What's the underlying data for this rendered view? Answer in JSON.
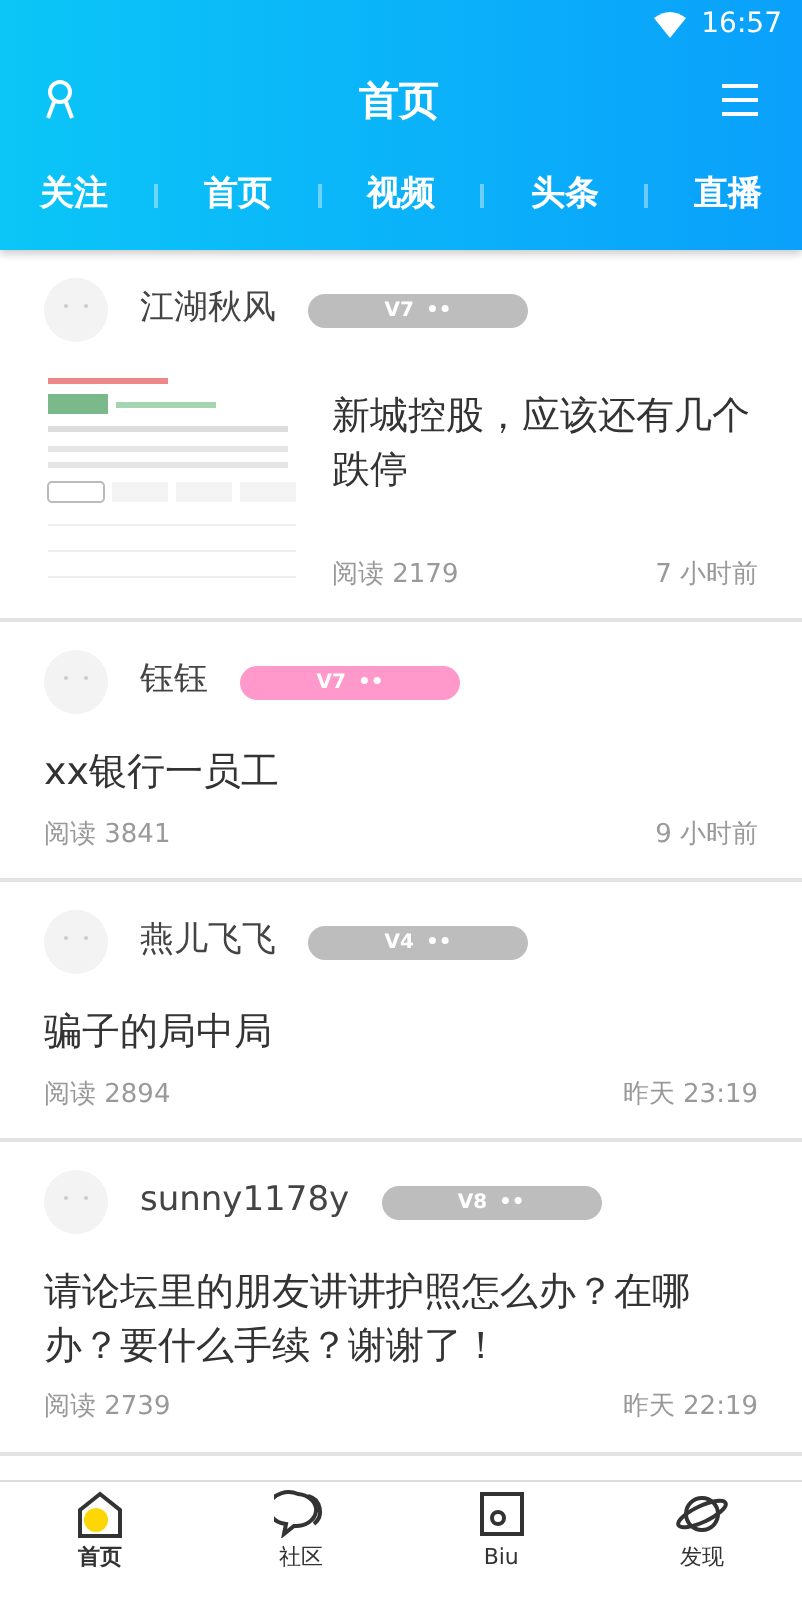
{
  "status_bar": {
    "time": "16:57"
  },
  "header": {
    "title": "首页"
  },
  "channels": [
    {
      "label": "关注"
    },
    {
      "label": "首页"
    },
    {
      "label": "视频"
    },
    {
      "label": "头条"
    },
    {
      "label": "直播"
    }
  ],
  "posts": [
    {
      "author": "江湖秋风",
      "level": "V7",
      "badge_dots": "••",
      "color": "#bdbdbd",
      "title": "新城控股，应该还有几个跌停",
      "reads": "阅读 2179",
      "time": "7 小时前"
    },
    {
      "author": "钰钰",
      "level": "V7",
      "badge_dots": "••",
      "color": "#ff99cc",
      "title": "xx银行一员工",
      "reads": "阅读 3841",
      "time": "9 小时前"
    },
    {
      "author": "燕儿飞飞",
      "level": "V4",
      "badge_dots": "••",
      "color": "#bdbdbd",
      "title": "骗子的局中局",
      "reads": "阅读 2894",
      "time": "昨天 23:19"
    },
    {
      "author": "sunny1178y",
      "level": "V8",
      "badge_dots": "••",
      "color": "#bdbdbd",
      "title": "请论坛里的朋友讲讲护照怎么办？在哪办？要什么手续？谢谢了！",
      "reads": "阅读 2739",
      "time": "昨天 22:19"
    }
  ],
  "bottom_nav": [
    {
      "label": "首页",
      "selected": true
    },
    {
      "label": "社区",
      "selected": false
    },
    {
      "label": "Biu",
      "selected": false
    },
    {
      "label": "发现",
      "selected": false
    }
  ]
}
